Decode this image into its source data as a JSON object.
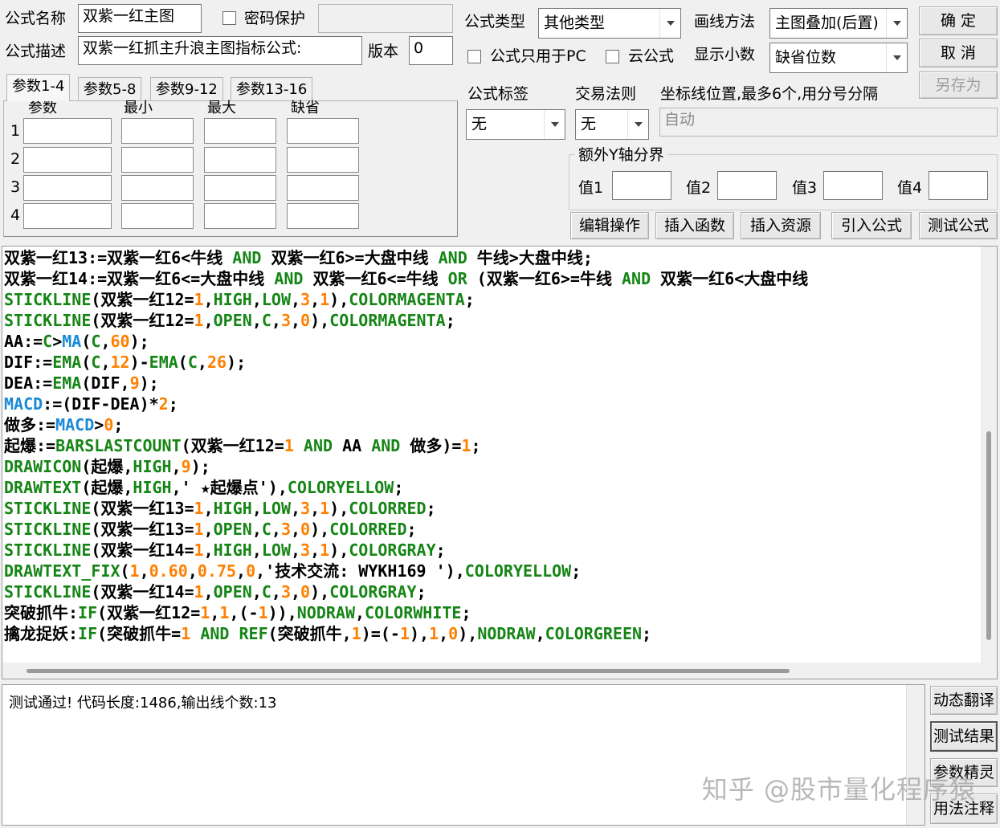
{
  "form": {
    "name_label": "公式名称",
    "name_value": "双紫一红主图",
    "password_label": "密码保护",
    "password_value": "",
    "desc_label": "公式描述",
    "desc_value": "双紫一红抓主升浪主图指标公式:",
    "version_label": "版本",
    "version_value": "0",
    "type_label": "公式类型",
    "type_value": "其他类型",
    "draw_label": "画线方法",
    "draw_value": "主图叠加(后置)",
    "pc_only_label": "公式只用于PC",
    "cloud_label": "云公式",
    "decimals_label": "显示小数",
    "decimals_value": "缺省位数",
    "tag_label": "公式标签",
    "tag_value": "无",
    "trade_rule_label": "交易法则",
    "trade_rule_value": "无",
    "axis_label": "坐标线位置,最多6个,用分号分隔",
    "axis_placeholder": "自动",
    "yaxis_group_label": "额外Y轴分界",
    "y_labels": [
      "值1",
      "值2",
      "值3",
      "值4"
    ]
  },
  "buttons": {
    "ok": "确 定",
    "cancel": "取 消",
    "save_as": "另存为",
    "edit_ops": "编辑操作",
    "insert_func": "插入函数",
    "insert_res": "插入资源",
    "import_formula": "引入公式",
    "test_formula": "测试公式",
    "dyn_translate": "动态翻译",
    "test_result": "测试结果",
    "param_wizard": "参数精灵",
    "usage_notes": "用法注释"
  },
  "tabs": [
    "参数1-4",
    "参数5-8",
    "参数9-12",
    "参数13-16"
  ],
  "param_headers": [
    "参数",
    "最小",
    "最大",
    "缺省"
  ],
  "param_rows": [
    "1",
    "2",
    "3",
    "4"
  ],
  "code_lines": [
    [
      [
        "t",
        "双紫一红13:=双紫一红6<牛线 "
      ],
      [
        "kw",
        "AND"
      ],
      [
        "t",
        " 双紫一红6>=大盘中线 "
      ],
      [
        "kw",
        "AND"
      ],
      [
        "t",
        " 牛线>大盘中线;"
      ]
    ],
    [
      [
        "t",
        "双紫一红14:=双紫一红6<=大盘中线 "
      ],
      [
        "kw",
        "AND"
      ],
      [
        "t",
        " 双紫一红6<=牛线 "
      ],
      [
        "kw",
        "OR"
      ],
      [
        "t",
        " (双紫一红6>=牛线 "
      ],
      [
        "kw",
        "AND"
      ],
      [
        "t",
        " 双紫一红6<大盘中线"
      ]
    ],
    [
      [
        "kw",
        "STICKLINE"
      ],
      [
        "t",
        "(双紫一红12="
      ],
      [
        "num",
        "1"
      ],
      [
        "t",
        ","
      ],
      [
        "kw",
        "HIGH"
      ],
      [
        "t",
        ","
      ],
      [
        "kw",
        "LOW"
      ],
      [
        "t",
        ","
      ],
      [
        "num",
        "3"
      ],
      [
        "t",
        ","
      ],
      [
        "num",
        "1"
      ],
      [
        "t",
        "),"
      ],
      [
        "kw",
        "COLORMAGENTA"
      ],
      [
        "t",
        ";"
      ]
    ],
    [
      [
        "kw",
        "STICKLINE"
      ],
      [
        "t",
        "(双紫一红12="
      ],
      [
        "num",
        "1"
      ],
      [
        "t",
        ","
      ],
      [
        "kw",
        "OPEN"
      ],
      [
        "t",
        ","
      ],
      [
        "kw",
        "C"
      ],
      [
        "t",
        ","
      ],
      [
        "num",
        "3"
      ],
      [
        "t",
        ","
      ],
      [
        "num",
        "0"
      ],
      [
        "t",
        "),"
      ],
      [
        "kw",
        "COLORMAGENTA"
      ],
      [
        "t",
        ";"
      ]
    ],
    [
      [
        "t",
        "AA:="
      ],
      [
        "kw",
        "C"
      ],
      [
        "t",
        ">"
      ],
      [
        "fn",
        "MA"
      ],
      [
        "t",
        "("
      ],
      [
        "kw",
        "C"
      ],
      [
        "t",
        ","
      ],
      [
        "num",
        "60"
      ],
      [
        "t",
        ");"
      ]
    ],
    [
      [
        "t",
        "DIF:="
      ],
      [
        "kw",
        "EMA"
      ],
      [
        "t",
        "("
      ],
      [
        "kw",
        "C"
      ],
      [
        "t",
        ","
      ],
      [
        "num",
        "12"
      ],
      [
        "t",
        ")-"
      ],
      [
        "kw",
        "EMA"
      ],
      [
        "t",
        "("
      ],
      [
        "kw",
        "C"
      ],
      [
        "t",
        ","
      ],
      [
        "num",
        "26"
      ],
      [
        "t",
        ");"
      ]
    ],
    [
      [
        "t",
        "DEA:="
      ],
      [
        "kw",
        "EMA"
      ],
      [
        "t",
        "(DIF,"
      ],
      [
        "num",
        "9"
      ],
      [
        "t",
        ");"
      ]
    ],
    [
      [
        "fn",
        "MACD"
      ],
      [
        "t",
        ":=(DIF-DEA)*"
      ],
      [
        "num",
        "2"
      ],
      [
        "t",
        ";"
      ]
    ],
    [
      [
        "t",
        "做多:="
      ],
      [
        "fn",
        "MACD"
      ],
      [
        "t",
        ">"
      ],
      [
        "num",
        "0"
      ],
      [
        "t",
        ";"
      ]
    ],
    [
      [
        "t",
        "起爆:="
      ],
      [
        "kw",
        "BARSLASTCOUNT"
      ],
      [
        "t",
        "(双紫一红12="
      ],
      [
        "num",
        "1"
      ],
      [
        "t",
        " "
      ],
      [
        "kw",
        "AND"
      ],
      [
        "t",
        " AA "
      ],
      [
        "kw",
        "AND"
      ],
      [
        "t",
        " 做多)="
      ],
      [
        "num",
        "1"
      ],
      [
        "t",
        ";"
      ]
    ],
    [
      [
        "kw",
        "DRAWICON"
      ],
      [
        "t",
        "(起爆,"
      ],
      [
        "kw",
        "HIGH"
      ],
      [
        "t",
        ","
      ],
      [
        "num",
        "9"
      ],
      [
        "t",
        ");"
      ]
    ],
    [
      [
        "kw",
        "DRAWTEXT"
      ],
      [
        "t",
        "(起爆,"
      ],
      [
        "kw",
        "HIGH"
      ],
      [
        "t",
        ",' ★起爆点'),"
      ],
      [
        "kw",
        "COLORYELLOW"
      ],
      [
        "t",
        ";"
      ]
    ],
    [
      [
        "kw",
        "STICKLINE"
      ],
      [
        "t",
        "(双紫一红13="
      ],
      [
        "num",
        "1"
      ],
      [
        "t",
        ","
      ],
      [
        "kw",
        "HIGH"
      ],
      [
        "t",
        ","
      ],
      [
        "kw",
        "LOW"
      ],
      [
        "t",
        ","
      ],
      [
        "num",
        "3"
      ],
      [
        "t",
        ","
      ],
      [
        "num",
        "1"
      ],
      [
        "t",
        "),"
      ],
      [
        "kw",
        "COLORRED"
      ],
      [
        "t",
        ";"
      ]
    ],
    [
      [
        "kw",
        "STICKLINE"
      ],
      [
        "t",
        "(双紫一红13="
      ],
      [
        "num",
        "1"
      ],
      [
        "t",
        ","
      ],
      [
        "kw",
        "OPEN"
      ],
      [
        "t",
        ","
      ],
      [
        "kw",
        "C"
      ],
      [
        "t",
        ","
      ],
      [
        "num",
        "3"
      ],
      [
        "t",
        ","
      ],
      [
        "num",
        "0"
      ],
      [
        "t",
        "),"
      ],
      [
        "kw",
        "COLORRED"
      ],
      [
        "t",
        ";"
      ]
    ],
    [
      [
        "kw",
        "STICKLINE"
      ],
      [
        "t",
        "(双紫一红14="
      ],
      [
        "num",
        "1"
      ],
      [
        "t",
        ","
      ],
      [
        "kw",
        "HIGH"
      ],
      [
        "t",
        ","
      ],
      [
        "kw",
        "LOW"
      ],
      [
        "t",
        ","
      ],
      [
        "num",
        "3"
      ],
      [
        "t",
        ","
      ],
      [
        "num",
        "1"
      ],
      [
        "t",
        "),"
      ],
      [
        "kw",
        "COLORGRAY"
      ],
      [
        "t",
        ";"
      ]
    ],
    [
      [
        "kw",
        "DRAWTEXT_FIX"
      ],
      [
        "t",
        "("
      ],
      [
        "num",
        "1"
      ],
      [
        "t",
        ","
      ],
      [
        "num",
        "0.60"
      ],
      [
        "t",
        ","
      ],
      [
        "num",
        "0.75"
      ],
      [
        "t",
        ","
      ],
      [
        "num",
        "0"
      ],
      [
        "t",
        ",'技术交流: WYKH169 '),"
      ],
      [
        "kw",
        "COLORYELLOW"
      ],
      [
        "t",
        ";"
      ]
    ],
    [
      [
        "kw",
        "STICKLINE"
      ],
      [
        "t",
        "(双紫一红14="
      ],
      [
        "num",
        "1"
      ],
      [
        "t",
        ","
      ],
      [
        "kw",
        "OPEN"
      ],
      [
        "t",
        ","
      ],
      [
        "kw",
        "C"
      ],
      [
        "t",
        ","
      ],
      [
        "num",
        "3"
      ],
      [
        "t",
        ","
      ],
      [
        "num",
        "0"
      ],
      [
        "t",
        "),"
      ],
      [
        "kw",
        "COLORGRAY"
      ],
      [
        "t",
        ";"
      ]
    ],
    [
      [
        "t",
        "突破抓牛:"
      ],
      [
        "kw",
        "IF"
      ],
      [
        "t",
        "(双紫一红12="
      ],
      [
        "num",
        "1"
      ],
      [
        "t",
        ","
      ],
      [
        "num",
        "1"
      ],
      [
        "t",
        ",(-"
      ],
      [
        "num",
        "1"
      ],
      [
        "t",
        ")),"
      ],
      [
        "kw",
        "NODRAW"
      ],
      [
        "t",
        ","
      ],
      [
        "kw",
        "COLORWHITE"
      ],
      [
        "t",
        ";"
      ]
    ],
    [
      [
        "t",
        "擒龙捉妖:"
      ],
      [
        "kw",
        "IF"
      ],
      [
        "t",
        "(突破抓牛="
      ],
      [
        "num",
        "1"
      ],
      [
        "t",
        " "
      ],
      [
        "kw",
        "AND"
      ],
      [
        "t",
        " "
      ],
      [
        "kw",
        "REF"
      ],
      [
        "t",
        "(突破抓牛,"
      ],
      [
        "num",
        "1"
      ],
      [
        "t",
        ")=(-"
      ],
      [
        "num",
        "1"
      ],
      [
        "t",
        "),"
      ],
      [
        "num",
        "1"
      ],
      [
        "t",
        ","
      ],
      [
        "num",
        "0"
      ],
      [
        "t",
        "),"
      ],
      [
        "kw",
        "NODRAW"
      ],
      [
        "t",
        ","
      ],
      [
        "kw",
        "COLORGREEN"
      ],
      [
        "t",
        ";"
      ]
    ]
  ],
  "result_text": "测试通过! 代码长度:1486,输出线个数:13",
  "watermark": "知乎 @股市量化程序猿"
}
